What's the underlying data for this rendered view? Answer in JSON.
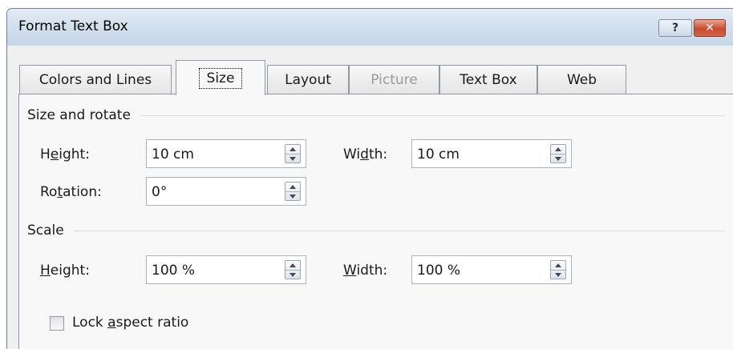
{
  "window": {
    "title": "Format Text Box",
    "help_glyph": "?",
    "close_glyph": "✕"
  },
  "tabs": [
    {
      "label": "Colors and Lines",
      "state": "normal"
    },
    {
      "label": "Size",
      "state": "active"
    },
    {
      "label": "Layout",
      "state": "normal"
    },
    {
      "label": "Picture",
      "state": "disabled"
    },
    {
      "label": "Text Box",
      "state": "normal"
    },
    {
      "label": "Web",
      "state": "normal"
    }
  ],
  "size_and_rotate": {
    "header": "Size and rotate",
    "height": {
      "label_pre": "H",
      "label_ul": "e",
      "label_post": "ight:",
      "value": "10 cm"
    },
    "width": {
      "label_pre": "Wi",
      "label_ul": "d",
      "label_post": "th:",
      "value": "10 cm"
    },
    "rotation": {
      "label_pre": "Ro",
      "label_ul": "t",
      "label_post": "ation:",
      "value": "0°"
    }
  },
  "scale": {
    "header": "Scale",
    "height": {
      "label_pre": "",
      "label_ul": "H",
      "label_post": "eight:",
      "value": "100 %"
    },
    "width": {
      "label_pre": "",
      "label_ul": "W",
      "label_post": "idth:",
      "value": "100 %"
    }
  },
  "lock_aspect": {
    "label_pre": "Lock ",
    "label_ul": "a",
    "label_post": "spect ratio",
    "checked": false
  },
  "colors": {
    "title_gradient_top": "#e4ecf5",
    "close_red": "#c84c2c",
    "disabled_text": "#9a9a9a"
  }
}
